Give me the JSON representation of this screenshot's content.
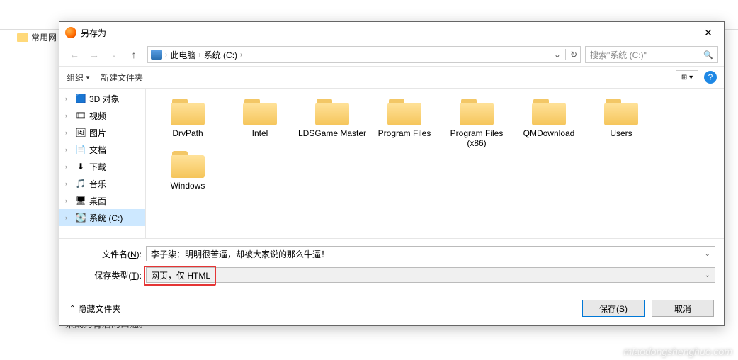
{
  "bg": {
    "tab_label": "常用网",
    "hidden_text": "来成为背后的口通。"
  },
  "dialog": {
    "title": "另存为",
    "close": "✕",
    "breadcrumb": {
      "root": "此电脑",
      "drive": "系统 (C:)",
      "dropdown": "⌄",
      "refresh": "↻"
    },
    "search": {
      "placeholder": "搜索\"系统 (C:)\"",
      "icon": "🔍"
    },
    "toolbar": {
      "organize": "组织",
      "new_folder": "新建文件夹",
      "view": "⊞ ▾",
      "help": "?"
    },
    "tree": [
      {
        "label": "3D 对象",
        "icon": "🟦"
      },
      {
        "label": "视频",
        "icon": "🎞"
      },
      {
        "label": "图片",
        "icon": "🖼"
      },
      {
        "label": "文档",
        "icon": "📄"
      },
      {
        "label": "下载",
        "icon": "⬇"
      },
      {
        "label": "音乐",
        "icon": "🎵"
      },
      {
        "label": "桌面",
        "icon": "🖥"
      },
      {
        "label": "系统 (C:)",
        "icon": "💽",
        "selected": true
      }
    ],
    "folders": [
      "DrvPath",
      "Intel",
      "LDSGame Master",
      "Program Files",
      "Program Files (x86)",
      "QMDownload",
      "Users",
      "Windows"
    ],
    "fields": {
      "filename_label_pre": "文件名(",
      "filename_label_u": "N",
      "filename_label_post": "):",
      "filename_value": "李子柒：明明很苦逼，却被大家说的那么牛逼！",
      "filetype_label_pre": "保存类型(",
      "filetype_label_u": "T",
      "filetype_label_post": "):",
      "filetype_value": "网页，仅 HTML"
    },
    "footer": {
      "hide_folders": "隐藏文件夹",
      "save": "保存(S)",
      "cancel": "取消",
      "chev": "⌃"
    }
  },
  "watermark": "miaodongshenghuo.com"
}
